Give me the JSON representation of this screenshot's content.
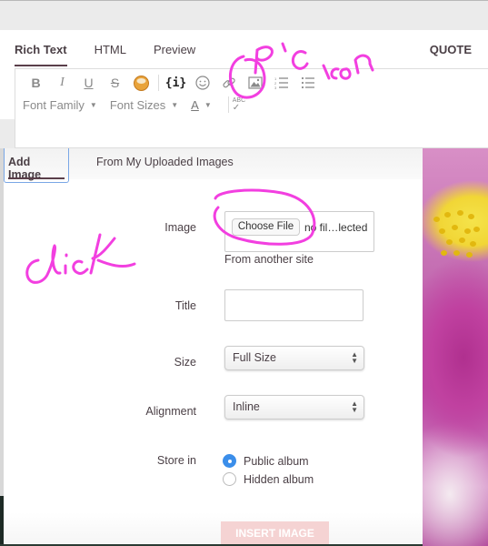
{
  "editor": {
    "tabs": [
      {
        "label": "Rich Text",
        "active": true
      },
      {
        "label": "HTML",
        "active": false
      },
      {
        "label": "Preview",
        "active": false
      }
    ],
    "quote_label": "QUOTE",
    "toolbar": {
      "buttons": [
        "bold",
        "italic",
        "underline",
        "strikethrough",
        "emoticon-cake",
        "code",
        "smiley",
        "link",
        "image",
        "ordered-list",
        "unordered-list"
      ],
      "code_glyph": "{i}",
      "font_family_label": "Font Family",
      "font_sizes_label": "Font Sizes",
      "font_color_label": "A",
      "spellcheck_label": "ABC"
    }
  },
  "modal": {
    "tabs": [
      {
        "label": "Add Image",
        "active": true
      },
      {
        "label": "From My Uploaded Images",
        "active": false
      }
    ],
    "image_label": "Image",
    "choose_file_label": "Choose File",
    "no_file_text": "no fil…lected",
    "another_site_link": "From another site",
    "title_label": "Title",
    "title_value": "",
    "size_label": "Size",
    "size_value": "Full Size",
    "alignment_label": "Alignment",
    "alignment_value": "Inline",
    "store_in_label": "Store in",
    "store_options": [
      {
        "label": "Public album",
        "selected": true
      },
      {
        "label": "Hidden album",
        "selected": false
      }
    ],
    "insert_button": "INSERT IMAGE"
  },
  "annotations": {
    "pic_icon_note": "Pic icon",
    "click_note": "click",
    "color": "#f23fe0"
  },
  "colors": {
    "accent_radio": "#3b8eea",
    "insert_button_bg": "#f5d3d3",
    "active_tab_underline": "#5a3f4a"
  }
}
